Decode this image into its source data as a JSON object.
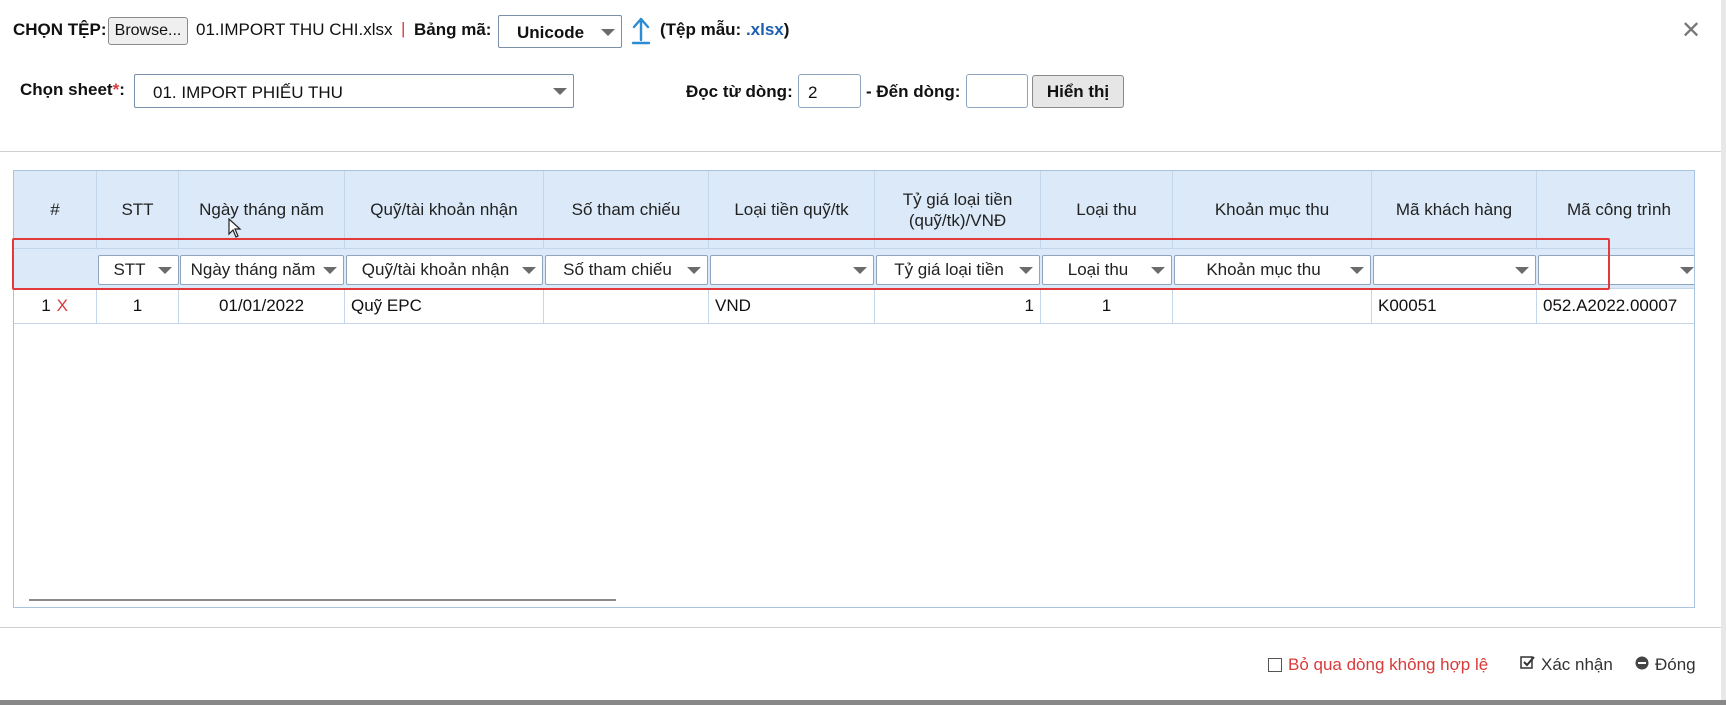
{
  "top": {
    "file_label": "CHỌN TỆP:",
    "browse_label": "Browse...",
    "file_name": "01.IMPORT THU CHI.xlsx",
    "separator": "|",
    "encoding_label": "Bảng mã:",
    "encoding_value": "Unicode",
    "template_open": "(Tệp mẫu: ",
    "template_link": ".xlsx",
    "template_close": ")",
    "close_symbol": "✕"
  },
  "row2": {
    "sheet_label": "Chọn sheet",
    "required_mark": "*",
    "colon": ":",
    "sheet_value": "01. IMPORT PHIẾU THU",
    "from_label": "Đọc từ dòng:",
    "from_value": "2",
    "to_label": "- Đến dòng:",
    "to_value": "",
    "show_button": "Hiển thị"
  },
  "table": {
    "headers": [
      "#",
      "STT",
      "Ngày tháng năm",
      "Quỹ/tài khoản nhận",
      "Số tham chiếu",
      "Loại tiền quỹ/tk",
      "Tỷ giá loại tiền (quỹ/tk)/VNĐ",
      "Loại thu",
      "Khoản mục thu",
      "Mã khách hàng",
      "Mã công trình"
    ],
    "filters": [
      "",
      "STT",
      "Ngày tháng năm",
      "Quỹ/tài khoản nhận",
      "Số tham chiếu",
      "",
      "Tỷ giá loại tiền",
      "Loại thu",
      "Khoản mục thu",
      "",
      ""
    ],
    "rows": [
      {
        "index": "1",
        "delete": "X",
        "cells": [
          "1",
          "01/01/2022",
          "Quỹ EPC",
          "",
          "VND",
          "1",
          "1",
          "",
          "K00051",
          "052.A2022.00007"
        ]
      }
    ]
  },
  "footer": {
    "skip_invalid": "Bỏ qua dòng không hợp lệ",
    "confirm": "Xác nhận",
    "close": "Đóng"
  },
  "colors": {
    "header_bg": "#dbe9f8",
    "highlight_border": "#e23a3a",
    "link_blue": "#1d5fb0",
    "upload_icon": "#2a8dd4",
    "danger_text": "#d93a3a"
  },
  "icons": {
    "upload": "upload-arrow-icon",
    "close": "close-icon",
    "checkbox": "checkbox-icon",
    "confirm": "check-square-icon",
    "close_circle": "minus-circle-icon"
  }
}
